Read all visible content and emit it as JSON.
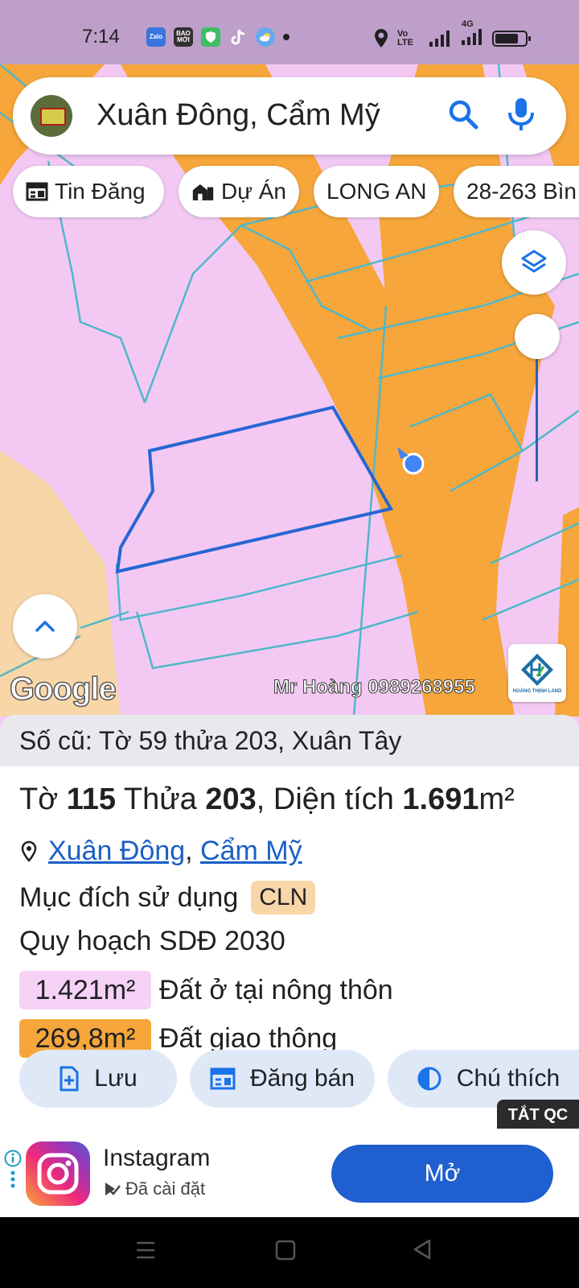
{
  "status_bar": {
    "time": "7:14",
    "apps": [
      {
        "name": "zalo-icon",
        "label": "Zalo",
        "color": "#2a6edb"
      },
      {
        "name": "baomoi-icon",
        "label": "BAO MỚI",
        "color": "#222222"
      },
      {
        "name": "shield-app-icon",
        "label": "",
        "color": "#2fbf5a"
      },
      {
        "name": "tiktok-icon",
        "label": "",
        "color": "#111111"
      },
      {
        "name": "weather-icon",
        "label": "",
        "color": "#58a8ef"
      }
    ],
    "network_label": "4G",
    "volte_label": "Vo LTE"
  },
  "search": {
    "query": "Xuân Đông, Cẩm Mỹ"
  },
  "chips": [
    {
      "label": "Tin Đăng",
      "icon": "listing-icon"
    },
    {
      "label": "Dự Án",
      "icon": "building-icon"
    },
    {
      "label": "LONG AN",
      "icon": ""
    },
    {
      "label": "28-263 Bìn",
      "icon": ""
    }
  ],
  "map": {
    "google_logo": "Google",
    "watermark": "Mr Hoàng 0989268955",
    "brand_text": "HOÀNG THỊNH LAND",
    "colors": {
      "residential": "#f3c9f4",
      "road": "#f6a63a",
      "agriculture": "#f9d6a8",
      "parcel_line": "#4fb8c9",
      "selected_parcel": "#2766d3"
    }
  },
  "panel": {
    "old_info": "Số cũ: Tờ 59 thửa 203, Xuân Tây",
    "parcel": {
      "to_label": "Tờ ",
      "to": "115",
      "thua_label": " Thửa ",
      "thua": "203",
      "area_label": ", Diện tích ",
      "area": "1.691",
      "unit": "m²"
    },
    "location": {
      "commune": "Xuân Đông",
      "separator": ", ",
      "district": "Cẩm Mỹ"
    },
    "purpose_label": "Mục đích sử dụng",
    "purpose_code": "CLN",
    "plan_title": "Quy hoạch SDĐ 2030",
    "plan_items": [
      {
        "area": "1.421m²",
        "label": "Đất ở tại nông thôn",
        "color": "#f7d2f7"
      },
      {
        "area": "269,8m²",
        "label": "Đất giao thông",
        "color": "#f6a63a"
      }
    ],
    "actions": [
      {
        "label": "Lưu",
        "icon": "save-icon"
      },
      {
        "label": "Đăng bán",
        "icon": "post-icon"
      },
      {
        "label": "Chú thích",
        "icon": "legend-icon"
      }
    ]
  },
  "ad": {
    "close_label": "TẮT QC",
    "app_name": "Instagram",
    "installed_label": "Đã cài đặt",
    "open_label": "Mở"
  }
}
